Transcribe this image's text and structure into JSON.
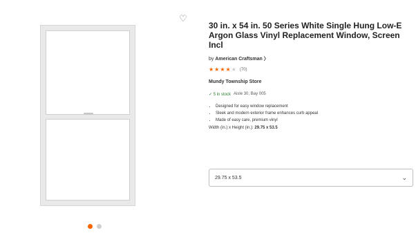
{
  "product": {
    "title": "30 in. x 54 in. 50 Series White Single Hung Low-E Argon Glass Vinyl Replacement Window, Screen Incl",
    "brand_prefix": "by",
    "brand": "American Craftsman",
    "brand_chevron": "〉",
    "rating": 4.5,
    "stars": [
      "★",
      "★",
      "★",
      "★",
      "★"
    ],
    "review_count": "(70)",
    "store": "Mundy Township Store",
    "stock_status": "✓ 5 in stock",
    "aisle_bay": "Aisle 30, Bay 005",
    "bullets": [
      "Designed for easy window replacement",
      "Sleek and modern exterior frame enhances curb appeal",
      "Made of easy care, premium vinyl"
    ],
    "size_label": "Width (in.) x Height (in.):",
    "size_value": "29.75 x 53.5",
    "selected_size": "29.75 x 53.5"
  },
  "icons": {
    "favorite": "♡",
    "dropdown": "⌄"
  },
  "colors": {
    "accent": "#f96302",
    "in_stock": "#2e7d32"
  }
}
